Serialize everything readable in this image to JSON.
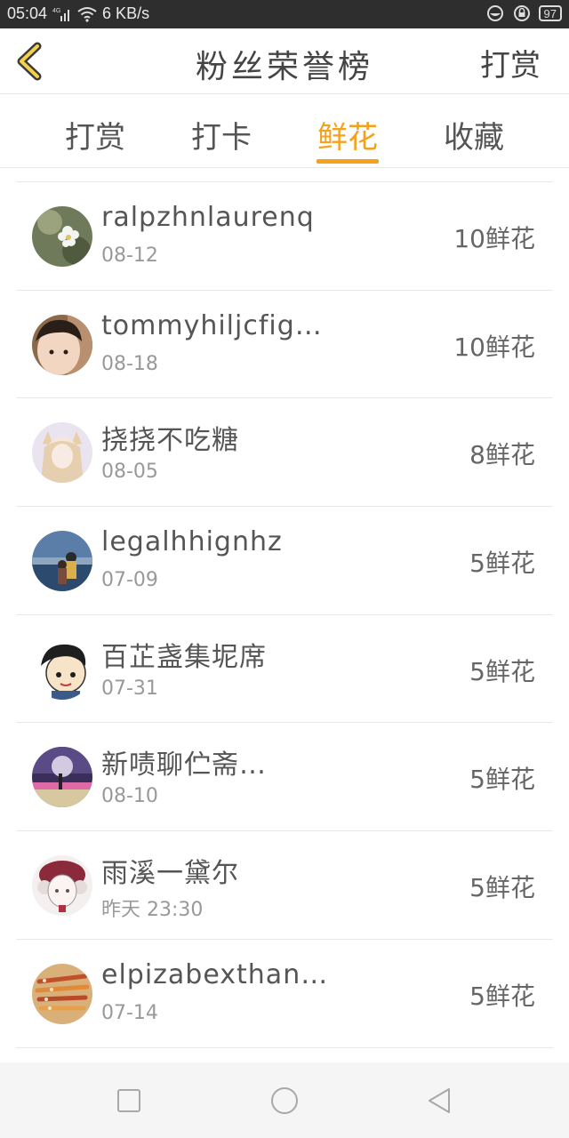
{
  "status_bar": {
    "time": "05:04",
    "network_speed": "6 KB/s",
    "battery": "97"
  },
  "header": {
    "title": "粉丝荣誉榜",
    "reward_label": "打赏"
  },
  "tabs": [
    {
      "label": "打赏",
      "active": false
    },
    {
      "label": "打卡",
      "active": false
    },
    {
      "label": "鲜花",
      "active": true
    },
    {
      "label": "收藏",
      "active": false
    }
  ],
  "fans": [
    {
      "name": "ralpzhnlaurenq",
      "date": "08-12",
      "count": "10鲜花",
      "avatar_icon": "flower-photo"
    },
    {
      "name": "tommyhiljcfig…",
      "date": "08-18",
      "count": "10鲜花",
      "avatar_icon": "child-photo"
    },
    {
      "name": "挠挠不吃糖",
      "date": "08-05",
      "count": "8鲜花",
      "avatar_icon": "anime-fox-girl"
    },
    {
      "name": "legalhhignhz",
      "date": "07-09",
      "count": "5鲜花",
      "avatar_icon": "couple-seaside"
    },
    {
      "name": "百芷盏集坭席",
      "date": "07-31",
      "count": "5鲜花",
      "avatar_icon": "cartoon-boy"
    },
    {
      "name": "新啧聊伫斋…",
      "date": "08-10",
      "count": "5鲜花",
      "avatar_icon": "night-scene"
    },
    {
      "name": "雨溪一黛尔",
      "date": "昨天 23:30",
      "count": "5鲜花",
      "avatar_icon": "anime-girl-sketch"
    },
    {
      "name": "elpizabexthan…",
      "date": "07-14",
      "count": "5鲜花",
      "avatar_icon": "pencils-photo"
    }
  ],
  "colors": {
    "accent": "#f5a11b",
    "status_bar_bg": "#2e2e2e"
  }
}
